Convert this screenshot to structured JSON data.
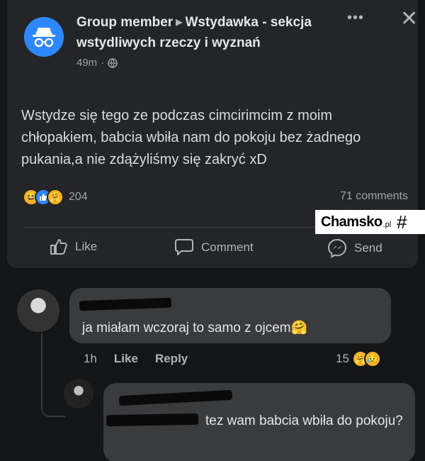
{
  "post": {
    "author": "Group member",
    "group": "Wstydawka - sekcja wstydliwych rzeczy i wyznań",
    "time": "49m",
    "text": "Wstydze się tego ze podczas cimcirimcim z moim chłopakiem, babcia wbiła nam do pokoju bez żadnego pukania,a nie zdążyliśmy się zakryć xD",
    "reaction_count": "204",
    "comment_count": "71 comments",
    "reactions": [
      "laugh-emoji",
      "like-emoji",
      "care-emoji"
    ]
  },
  "actions": {
    "like": "Like",
    "comment": "Comment",
    "send": "Send"
  },
  "watermark": {
    "brand": "Chamsko",
    "suffix": ".pl",
    "symbol": "#"
  },
  "comments": [
    {
      "text": "ja miałam wczoraj to samo z ojcem🤗",
      "time": "1h",
      "like": "Like",
      "reply": "Reply",
      "reaction_count": "15"
    },
    {
      "text": "tez wam babcia wbiła do pokoju?"
    }
  ],
  "colors": {
    "background": "#141516",
    "card": "#242526",
    "bubble": "#3a3b3c",
    "accent": "#2d88ff"
  }
}
